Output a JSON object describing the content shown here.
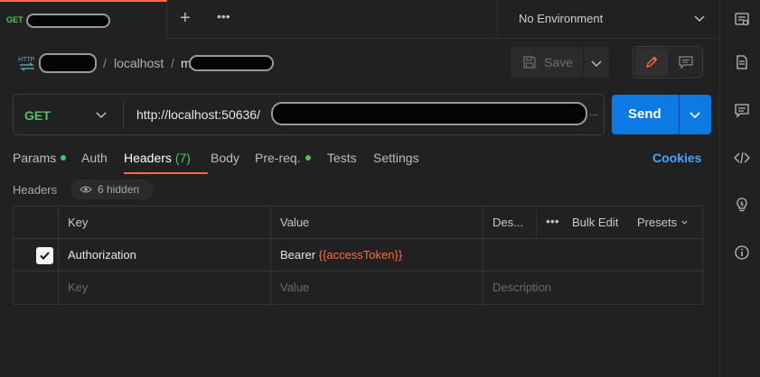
{
  "tab": {
    "method": "GET"
  },
  "environment": {
    "label": "No Environment"
  },
  "breadcrumb": {
    "separator": "/",
    "workspace": "localhost",
    "request_prefix": "m"
  },
  "toolbar": {
    "save_label": "Save"
  },
  "request": {
    "method": "GET",
    "url_visible": "http://localhost:50636/",
    "url_overflow": "..."
  },
  "send": {
    "label": "Send"
  },
  "tabs": [
    {
      "label": "Params",
      "dot": true
    },
    {
      "label": "Auth"
    },
    {
      "label": "Headers",
      "count": "(7)",
      "active": true
    },
    {
      "label": "Body"
    },
    {
      "label": "Pre-req.",
      "dot": true
    },
    {
      "label": "Tests"
    },
    {
      "label": "Settings"
    }
  ],
  "cookies_label": "Cookies",
  "headers_section": {
    "title": "Headers",
    "hidden_label": "6 hidden"
  },
  "table": {
    "columns": {
      "key": "Key",
      "value": "Value",
      "description": "Des...",
      "bulk_edit": "Bulk Edit",
      "presets": "Presets"
    },
    "rows": [
      {
        "checked": true,
        "key": "Authorization",
        "value_prefix": "Bearer",
        "value_var": "{{accessToken}}",
        "description": ""
      }
    ],
    "placeholders": {
      "key": "Key",
      "value": "Value",
      "description": "Description"
    }
  },
  "colors": {
    "accent": "#ff6c37",
    "send": "#0c7ae3",
    "get": "#4ec463",
    "link": "#4aa3ff"
  }
}
